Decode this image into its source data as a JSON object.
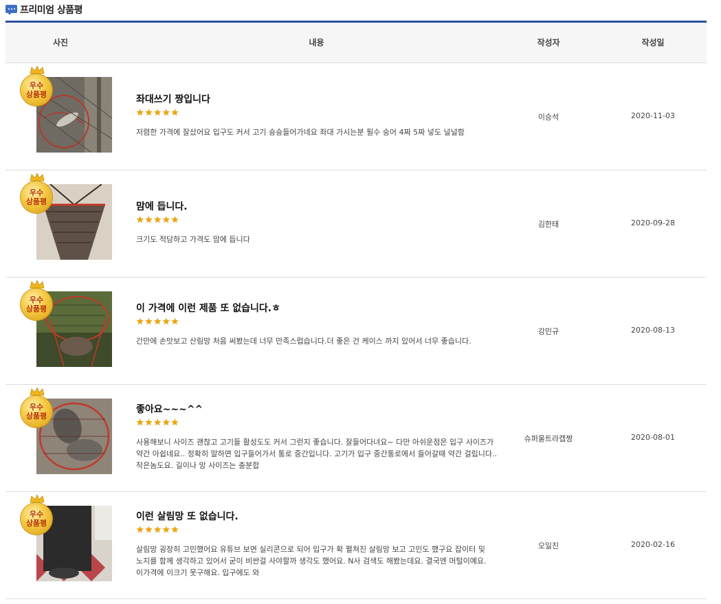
{
  "header": {
    "title": "프리미엄 상품평"
  },
  "columns": {
    "photo": "사진",
    "content": "내용",
    "author": "작성자",
    "date": "작성일"
  },
  "badge": {
    "line1": "우수",
    "line2": "상품평"
  },
  "colors": {
    "accent": "#2c4f9e",
    "star": "#f0a500",
    "badge": "#f5c842"
  },
  "reviews": [
    {
      "title": "좌대쓰기 짱입니다",
      "rating": 5,
      "body": "저렴한 가격에 잘샀어요 입구도 커서 고기 숑숑들어가네요 좌대 가시는분 필수 숭어 4짜 5짜 넣도 널널함",
      "author": "이승석",
      "date": "2020-11-03"
    },
    {
      "title": "맘에 듭니다.",
      "rating": 5,
      "body": "크기도 적당하고 가격도 맘에 듭니다",
      "author": "김한태",
      "date": "2020-09-28"
    },
    {
      "title": "이 가격에 이런 제품 또 없습니다.ㅎ",
      "rating": 5,
      "body": "간만에 손맛보고 산림망 처음 써봤는데 너무 만족스럽습니다.더 좋은 건 케이스 까지 있어서 너무 좋습니다.",
      "author": "강민규",
      "date": "2020-08-13"
    },
    {
      "title": "좋아요~~~^^",
      "rating": 5,
      "body": "사용해보니 사이즈 괜찮고 고기들 활성도도 커서 그런지 좋습니다. 잘들어다녀요~ 다만 아쉬운점은 입구 사이즈가 약간 아쉽네요.. 정확히 말하면 입구들어가서 통로 중간입니다. 고기가 입구 중간통로에서 들어갈때 약간 걸립니다.. 작은놈도요. 길이나 망 사이즈는 충분합",
      "author": "슈퍼울트라캡짱",
      "date": "2020-08-01"
    },
    {
      "title": "이런 살림망 또 없습니다.",
      "rating": 5,
      "body": "살림망 굉장히 고민했어요 유튜브 보면 실리콘으로 되어 입구가 확 펼쳐진 살림망 보고 고민도 했구요 잡이터 및 노지를 함께 생각하고 있어서 굳이 비싼걸 사야할까 생각도 했어요. N사 검색도 해봤는데요. 결국엔 머털이예요. 이가격에 이크기 못구해요. 입구에도 와",
      "author": "오일진",
      "date": "2020-02-16"
    }
  ]
}
